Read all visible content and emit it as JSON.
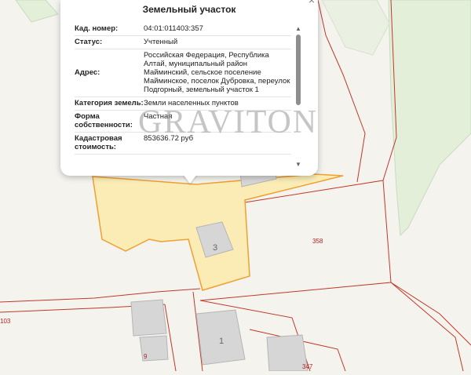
{
  "popup": {
    "title": "Земельный участок",
    "close": "×",
    "rows": [
      {
        "label": "Кад. номер:",
        "value": "04:01:011403:357"
      },
      {
        "label": "Статус:",
        "value": "Учтенный"
      },
      {
        "label": "Адрес:",
        "value": "Российская Федерация, Республика Алтай, муниципальный район Майминский, сельское поселение Майминское, поселок Дубровка, переулок Подгорный, земельный участок 1"
      },
      {
        "label": "Категория земель:",
        "value": "Земли населенных пунктов"
      },
      {
        "label": "Форма собственности:",
        "value": "Частная"
      },
      {
        "label": "Кадастровая стоимость:",
        "value": "853636.72 руб"
      }
    ]
  },
  "map": {
    "parcel_labels": [
      "358",
      "103",
      "9",
      "347"
    ],
    "building_labels": [
      "3",
      "1"
    ],
    "watermark": "GRAVITON",
    "colors": {
      "background": "#f4f3ee",
      "green_area": "#e3efd9",
      "selected_parcel_fill": "#fbeaaa",
      "selected_parcel_stroke": "#f0a030",
      "boundary_line": "#c0392b",
      "building": "#d6d6d6"
    }
  }
}
